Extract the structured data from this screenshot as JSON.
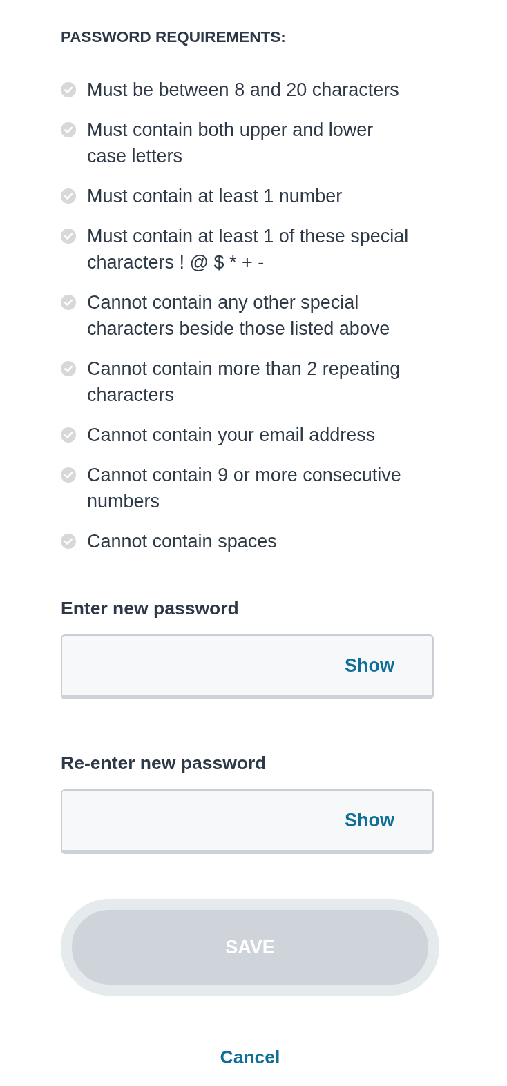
{
  "heading": "PASSWORD REQUIREMENTS:",
  "requirements": [
    {
      "text": "Must be between 8 and 20 characters",
      "met": false
    },
    {
      "text": "Must contain both upper and lower case letters",
      "met": false
    },
    {
      "text": "Must contain at least 1 number",
      "met": false
    },
    {
      "text": "Must contain at least 1 of these special characters ! @ $ * + -",
      "met": false
    },
    {
      "text": "Cannot contain any other special characters beside those listed above",
      "met": false
    },
    {
      "text": "Cannot contain more than 2 repeating characters",
      "met": false
    },
    {
      "text": "Cannot contain your email address",
      "met": false
    },
    {
      "text": "Cannot contain 9 or more consecutive numbers",
      "met": false
    },
    {
      "text": "Cannot contain spaces",
      "met": false
    }
  ],
  "fields": [
    {
      "label": "Enter new password",
      "toggle": "Show"
    },
    {
      "label": "Re-enter new password",
      "toggle": "Show"
    }
  ],
  "save_button": {
    "label": "SAVE",
    "disabled": true
  },
  "cancel_link": "Cancel"
}
